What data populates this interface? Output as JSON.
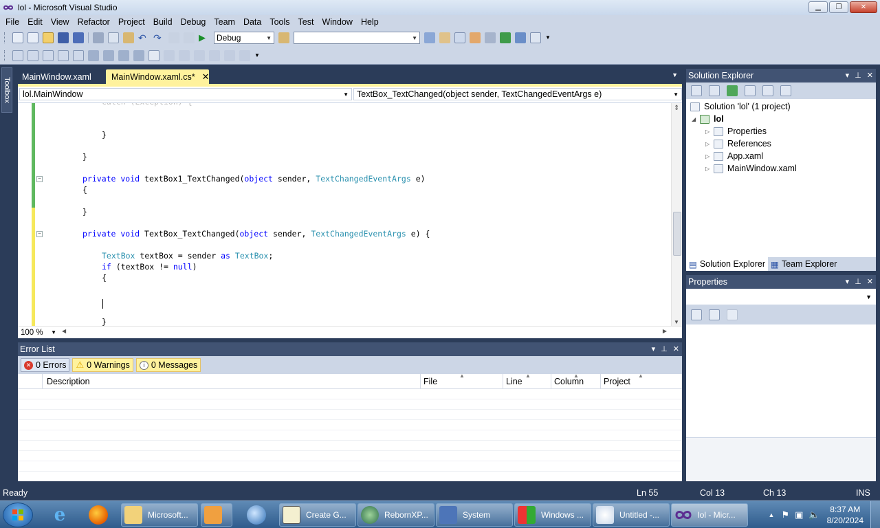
{
  "window": {
    "title": "lol - Microsoft Visual Studio"
  },
  "menu": [
    "File",
    "Edit",
    "View",
    "Refactor",
    "Project",
    "Build",
    "Debug",
    "Team",
    "Data",
    "Tools",
    "Test",
    "Window",
    "Help"
  ],
  "toolbar": {
    "config_value": "Debug",
    "platform_value": ""
  },
  "toolbox": {
    "label": "Toolbox"
  },
  "doc_tabs": {
    "inactive": "MainWindow.xaml",
    "active": "MainWindow.xaml.cs*"
  },
  "nav": {
    "class_dd": "lol.MainWindow",
    "member_dd": "TextBox_TextChanged(object sender, TextChangedEventArgs e)"
  },
  "code": {
    "l1": "}",
    "l2": "}",
    "l3_kw": "private void",
    "l3_name": " textBox1_TextChanged(",
    "l3_obj": "object",
    "l3_sender": " sender, ",
    "l3_type": "TextChangedEventArgs",
    "l3_end": " e)",
    "l4": "{",
    "l5": "}",
    "l6_kw": "private void",
    "l6_name": " TextBox_TextChanged(",
    "l6_obj": "object",
    "l6_sender": " sender, ",
    "l6_type": "TextChangedEventArgs",
    "l6_end": " e) {",
    "l7_type": "TextBox",
    "l7_mid": " textBox = sender ",
    "l7_as": "as",
    "l7_sp": " ",
    "l7_type2": "TextBox",
    "l7_end": ";",
    "l8_if": "if",
    "l8_mid": " (textBox != ",
    "l8_null": "null",
    "l8_end": ")",
    "l9": "{",
    "l10": "}"
  },
  "editor_bottom": {
    "zoom": "100 %"
  },
  "error_list": {
    "title": "Error List",
    "errors": "0 Errors",
    "warnings": "0 Warnings",
    "messages": "0 Messages",
    "columns": [
      "Description",
      "File",
      "Line",
      "Column",
      "Project"
    ]
  },
  "solution_explorer": {
    "title": "Solution Explorer",
    "solution": "Solution 'lol' (1 project)",
    "project": "lol",
    "items": [
      "Properties",
      "References",
      "App.xaml",
      "MainWindow.xaml"
    ],
    "tab_active": "Solution Explorer",
    "tab_other": "Team Explorer"
  },
  "properties": {
    "title": "Properties"
  },
  "status": {
    "ready": "Ready",
    "ln": "Ln 55",
    "col": "Col 13",
    "ch": "Ch 13",
    "ins": "INS"
  },
  "taskbar": {
    "buttons": [
      "Microsoft...",
      "",
      "Create G...",
      "RebornXP...",
      "System",
      "Windows ...",
      "Untitled -...",
      "lol - Micr..."
    ],
    "time": "8:37 AM",
    "date": "8/20/2024"
  },
  "colors": {
    "accent_tab": "#fff29d",
    "chrome": "#2b3c59",
    "keyword": "#0000ff",
    "type": "#2b91af"
  }
}
